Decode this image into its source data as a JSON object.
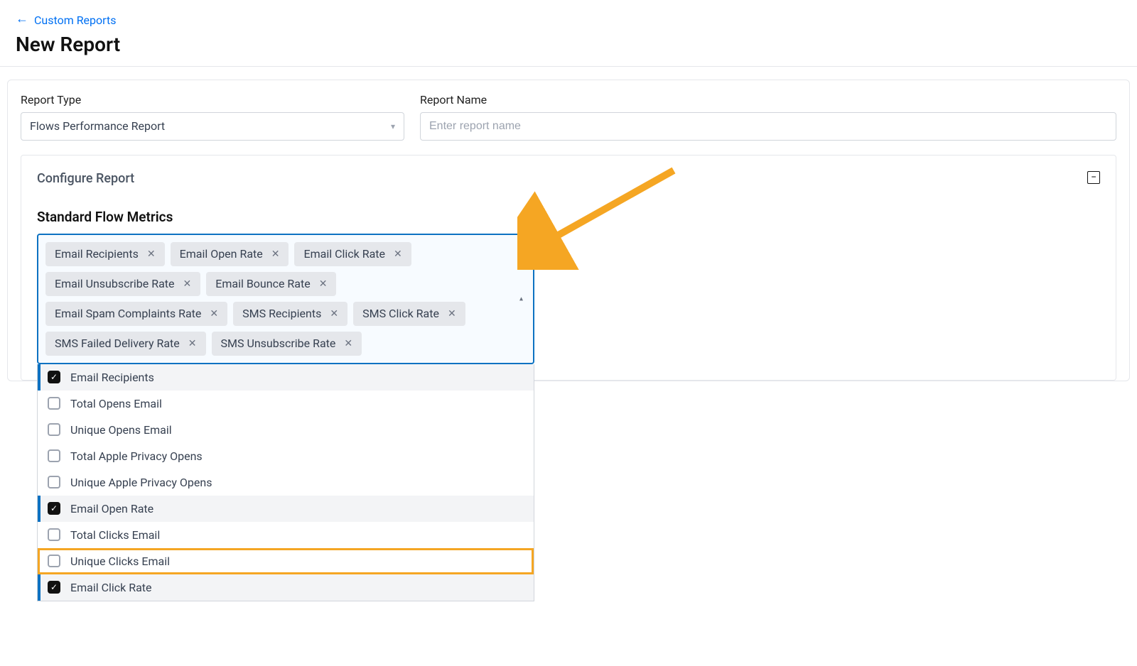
{
  "breadcrumb": {
    "label": "Custom Reports"
  },
  "page": {
    "title": "New Report"
  },
  "form": {
    "report_type": {
      "label": "Report Type",
      "selected": "Flows Performance Report"
    },
    "report_name": {
      "label": "Report Name",
      "placeholder": "Enter report name",
      "value": ""
    }
  },
  "configure": {
    "title": "Configure Report",
    "section_title": "Standard Flow Metrics",
    "selected_chips": [
      "Email Recipients",
      "Email Open Rate",
      "Email Click Rate",
      "Email Unsubscribe Rate",
      "Email Bounce Rate",
      "Email Spam Complaints Rate",
      "SMS Recipients",
      "SMS Click Rate",
      "SMS Failed Delivery Rate",
      "SMS Unsubscribe Rate"
    ],
    "options": [
      {
        "label": "Email Recipients",
        "checked": true,
        "highlighted": false
      },
      {
        "label": "Total Opens Email",
        "checked": false,
        "highlighted": false
      },
      {
        "label": "Unique Opens Email",
        "checked": false,
        "highlighted": false
      },
      {
        "label": "Total Apple Privacy Opens",
        "checked": false,
        "highlighted": false
      },
      {
        "label": "Unique Apple Privacy Opens",
        "checked": false,
        "highlighted": false
      },
      {
        "label": "Email Open Rate",
        "checked": true,
        "highlighted": false
      },
      {
        "label": "Total Clicks Email",
        "checked": false,
        "highlighted": false
      },
      {
        "label": "Unique Clicks Email",
        "checked": false,
        "highlighted": true
      },
      {
        "label": "Email Click Rate",
        "checked": true,
        "highlighted": false
      }
    ]
  },
  "colors": {
    "brand_blue": "#0070f3",
    "focus_blue": "#0d72c2",
    "highlight_orange": "#f5a623"
  }
}
